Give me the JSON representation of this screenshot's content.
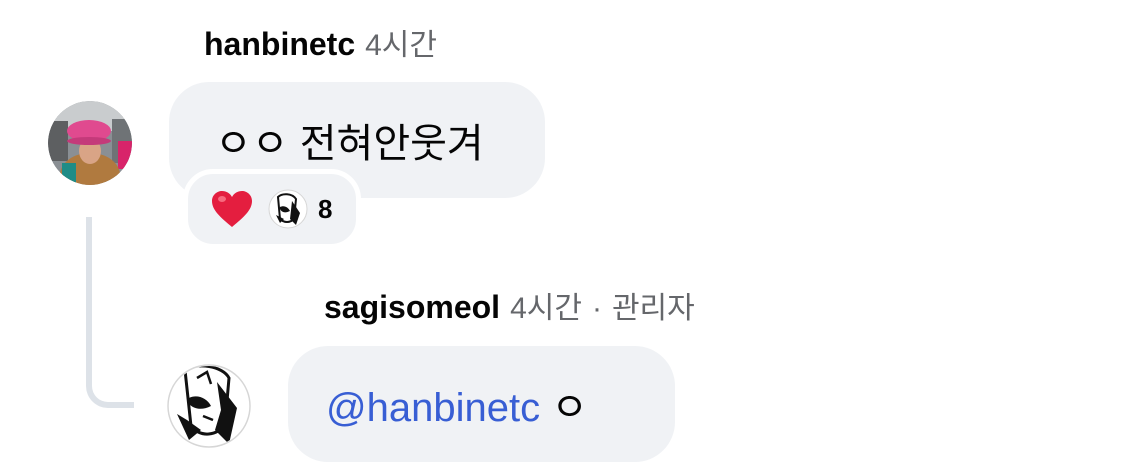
{
  "comment": {
    "username": "hanbinetc",
    "time": "4시간",
    "text": "ㅇㅇ 전혀안웃겨",
    "avatar_icon": "user-photo-avatar",
    "reactions": {
      "emoji": "❤️",
      "heart_color": "#e41e3f",
      "count": "8"
    }
  },
  "reply": {
    "username": "sagisomeol",
    "time": "4시간",
    "separator": "·",
    "role": "관리자",
    "mention": "@hanbinetc",
    "text": " ㅇ",
    "avatar_icon": "manga-face-avatar",
    "mention_color": "#385ed4"
  }
}
